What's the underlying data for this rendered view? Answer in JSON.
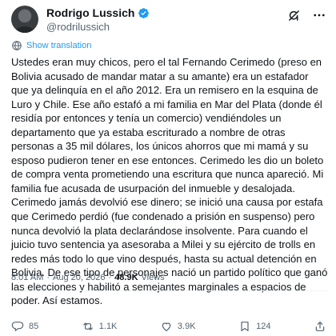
{
  "author": {
    "name": "Rodrigo Lussich",
    "handle": "@rodrilussich"
  },
  "translate": {
    "label": "Show translation"
  },
  "tweet": {
    "text": "Ustedes eran muy chicos, pero el tal Fernando Cerimedo (preso en Bolivia acusado de mandar matar a su amante) era un estafador que ya delinquía en el año 2012. Era un remisero en la esquina de Luro y Chile. Ese año estafó a mi familia en Mar del Plata (donde él residía por entonces y tenía un comercio) vendiéndoles un departamento que ya estaba escriturado a nombre de otras personas a 35 mil dólares, los únicos ahorros que mi mamá y su esposo pudieron tener en ese entonces. Cerimedo les dio un boleto de compra venta prometiendo una escritura que nunca apareció. Mi familia fue acusada de usurpación del inmueble y desalojada. Cerimedo jamás devolvió ese dinero; se inició una causa por estafa que Cerimedo perdió (fue condenado a prisión en suspenso) pero nunca devolvió la plata declarándose insolvente. Para cuando el juicio tuvo sentencia ya asesoraba a Milei y su ejército de trolls en redes más todo lo que vino después, hasta su actual detención en Bolivia. De ese tipo de personajes nació un partido político que ganó las elecciones y habilitó a semejantes marginales a espacios de poder. Así estamos."
  },
  "meta": {
    "time": "8:01 AM",
    "separator": "·",
    "date": "Aug 20, 2026",
    "views_count": "48.9K",
    "views_label": "Views"
  },
  "actions": {
    "replies": "85",
    "reposts": "1.1K",
    "likes": "3.9K",
    "bookmarks": "124"
  },
  "colors": {
    "link": "#1d9bf0",
    "secondary_text": "#536471",
    "verified": "#1d9bf0"
  },
  "icons": [
    "verified-badge-icon",
    "grok-icon",
    "more-icon",
    "translate-icon",
    "reply-icon",
    "repost-icon",
    "like-icon",
    "bookmark-icon",
    "share-icon"
  ]
}
